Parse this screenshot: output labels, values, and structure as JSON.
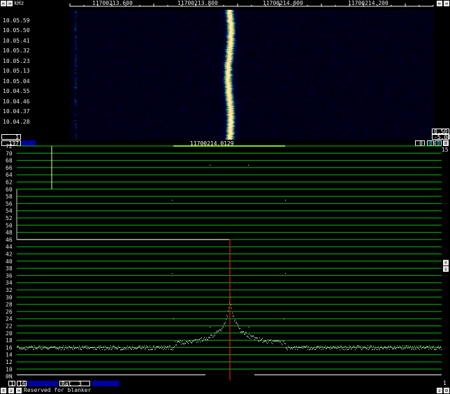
{
  "topbar": {
    "unit": "kHz",
    "freq_ticks": [
      "11700213.600",
      "11700213.800",
      "11700214.000",
      "11700214.200"
    ]
  },
  "waterfall": {
    "times": [
      "10.05.59",
      "10.05.50",
      "10.05.41",
      "10.05.32",
      "10.05.23",
      "10.05.13",
      "10.05.04",
      "10.04.55",
      "10.04.46",
      "10.04.37",
      "10.04.28"
    ],
    "bottom_box": "1",
    "right_box_1": "0.50",
    "right_box_2": "-5.00"
  },
  "midbar": {
    "left_value": "137",
    "center_freq": "11700214.0129",
    "right_box_1": "0",
    "right_box_2": "0",
    "right_box_3": "0",
    "right_number": "15"
  },
  "spectrum": {
    "y_labels": [
      "72",
      "70",
      "68",
      "66",
      "64",
      "62",
      "60",
      "58",
      "56",
      "54",
      "52",
      "50",
      "48",
      "46",
      "44",
      "42",
      "40",
      "38",
      "36",
      "34",
      "32",
      "30",
      "28",
      "26",
      "24",
      "22",
      "20",
      "18",
      "16",
      "14",
      "12",
      "10",
      "0N"
    ],
    "colors": {
      "grid": "#00c000",
      "trace": "#ffffff",
      "marker": "#ff2020",
      "meter": "#ffff80"
    }
  },
  "bottom": {
    "box_1": "1",
    "box_2": "16",
    "rat_label": "Rat",
    "rat_value": "3",
    "status_text": "Reserved for blanker",
    "right_number": "1"
  }
}
